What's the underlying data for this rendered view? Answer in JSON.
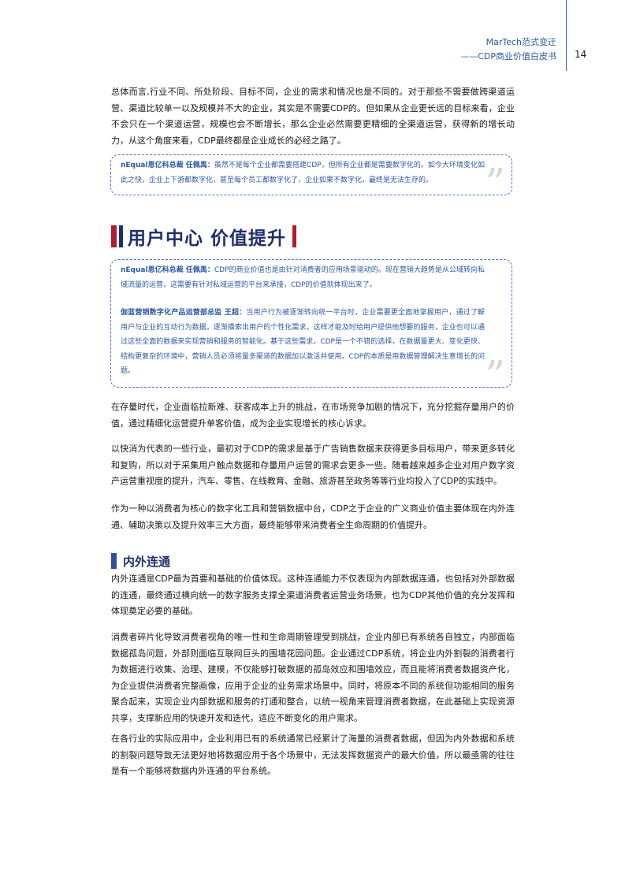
{
  "header": {
    "title": "MarTech范式变迁",
    "subtitle": "——CDP商业价值白皮书",
    "page_number": "14"
  },
  "intro_paragraph": "总体而言,行业不同、所处阶段、目标不同，企业的需求和情况也是不同的。对于那些不需要做跨渠道运营、渠道比较单一以及规模并不大的企业，其实是不需要CDP的。但如果从企业更长远的目标来看，企业不会只在一个渠道运营，规模也会不断增长，那么企业必然需要更精细的全渠道运营，获得新的增长动力，从这个角度来看，CDP最终都是企业成长的必经之路了。",
  "quote1": {
    "speaker": "nEqual恩亿科总裁 任佩禹：",
    "text": "虽然不是每个企业都需要搭建CDP，但所有企业都是需要数字化的。如今大环境变化如此之快，企业上下游都数字化，甚至每个员工都数字化了，企业如果不数字化，最终是无法生存的。"
  },
  "section_title": "用户中心 价值提升",
  "quote2": {
    "speaker1": "nEqual恩亿科总裁 任佩禹：",
    "text1": "CDP的商业价值也是由针对消费者的应用场景驱动的。现在营销大趋势是从公域转向私域流量的运营，这需要有针对私域运营的平台来承接，CDP的价值就体现出来了。",
    "speaker2": "伽蓝营销数字化产品运营部总监 王超：",
    "text2": "当用户行为被逐渐转向统一平台时，企业需要更全面地掌握用户，通过了解用户与企业的互动行为数据，逐渐摸索出用户的个性化需求，这样才能及时给用户提供他想要的服务，企业也可以通过这些全面的数据来实现营销和服务的智能化。基于这些需求，CDP是一个不错的选择，在数据量更大、变化更快、结构更复杂的环境中，营销人员必须将量多渠道的数据加以激活并使用。CDP的本质是用数据管理解决生意增长的问题。"
  },
  "para2": "在存量时代，企业面临拉新难、获客成本上升的挑战，在市场竞争加剧的情况下，充分挖掘存量用户的价值，通过精细化运营提升单客价值，成为企业实现增长的核心诉求。",
  "para3": "以快消为代表的一些行业，最初对于CDP的需求是基于广告销售数据来获得更多目标用户，带来更多转化和复购，所以对于采集用户触点数据和存量用户运营的需求会更多一些。随着越来越多企业对用户数字资产运营重视度的提升，汽车、零售、在线教育、金融、旅游甚至政务等等行业均投入了CDP的实践中。",
  "para4": "作为一种以消费者为核心的数字化工具和营销数据中台，CDP之于企业的广义商业价值主要体现在内外连通、辅助决策以及提升效率三大方面，最终能够带来消费者全生命周期的价值提升。",
  "subsection_title": "内外连通",
  "para5": "内外连通是CDP最为首要和基础的价值体现。这种连通能力不仅表现为内部数据连通，也包括对外部数据的连通，最终通过横向统一的数字服务支撑全渠道消费者运营业务场景，也为CDP其他价值的充分发挥和体现奠定必要的基础。",
  "para6": "消费者碎片化导致消费者视角的唯一性和生命周期管理受到挑战，企业内部已有系统各自独立，内部面临数据孤岛问题，外部则面临互联网巨头的围墙花园问题。企业通过CDP系统，将企业内外割裂的消费者行为数据进行收集、治理、建模，不仅能够打破数据的孤岛效应和围墙效应，而且能将消费者数据资产化，为企业提供消费者完整画像，应用于企业的业务需求场景中。同时，将原本不同的系统但功能相同的服务聚合起来，实现企业内部数据和服务的打通和整合，以统一视角来管理消费者数据，在此基础上实现资源共享，支撑新应用的快速开发和迭代，适应不断变化的用户需求。",
  "para7": "在各行业的实际应用中，企业利用已有的系统通常已经累计了海量的消费者数据，但因为内外数据和系统的割裂问题导致无法更好地将数据应用于各个场景中，无法发挥数据资产的最大价值，所以最亟需的往往是有一个能够将数据内外连通的平台系统。"
}
